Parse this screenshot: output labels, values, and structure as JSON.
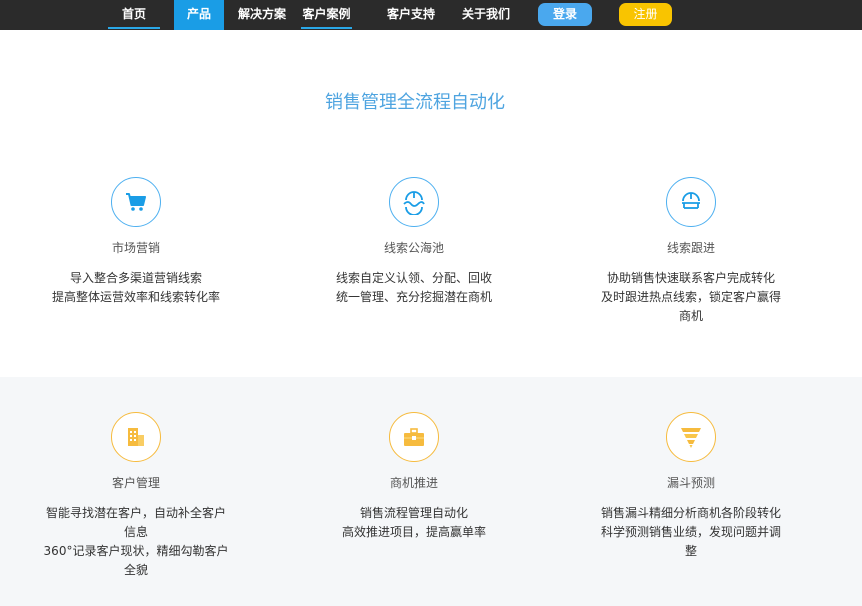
{
  "nav": {
    "items": [
      {
        "label": "首页"
      },
      {
        "label": "产品"
      },
      {
        "label": "解决方案"
      },
      {
        "label": "客户案例"
      },
      {
        "label": "客户支持"
      },
      {
        "label": "关于我们"
      }
    ],
    "login_label": "登录",
    "register_label": "注册"
  },
  "colors": {
    "nav_bg": "#2b2b2b",
    "accent_blue": "#1a9de6",
    "login_blue": "#4aa8ee",
    "register_yellow": "#f9c400",
    "icon_blue": "#4eb0f0",
    "icon_orange": "#f6bb3e"
  },
  "section": {
    "title": "销售管理全流程自动化"
  },
  "features": [
    {
      "icon": "shopping-cart-icon",
      "title": "市场营销",
      "lines": [
        "导入整合多渠道营销线索",
        "提高整体运营效率和线索转化率"
      ]
    },
    {
      "icon": "clue-pool-icon",
      "title": "线索公海池",
      "lines": [
        "线索自定义认领、分配、回收",
        "统一管理、充分挖掘潜在商机"
      ]
    },
    {
      "icon": "clue-follow-icon",
      "title": "线索跟进",
      "lines": [
        "协助销售快速联系客户完成转化",
        "及时跟进热点线索，锁定客户赢得",
        "商机"
      ]
    },
    {
      "icon": "buildings-icon",
      "title": "客户管理",
      "lines": [
        "智能寻找潜在客户，自动补全客户",
        "信息",
        "360°记录客户现状，精细勾勒客户",
        "全貌"
      ]
    },
    {
      "icon": "briefcase-icon",
      "title": "商机推进",
      "lines": [
        "销售流程管理自动化",
        "高效推进项目，提高赢单率"
      ]
    },
    {
      "icon": "funnel-icon",
      "title": "漏斗预测",
      "lines": [
        "销售漏斗精细分析商机各阶段转化",
        "科学预测销售业绩，发现问题并调",
        "整"
      ]
    }
  ]
}
